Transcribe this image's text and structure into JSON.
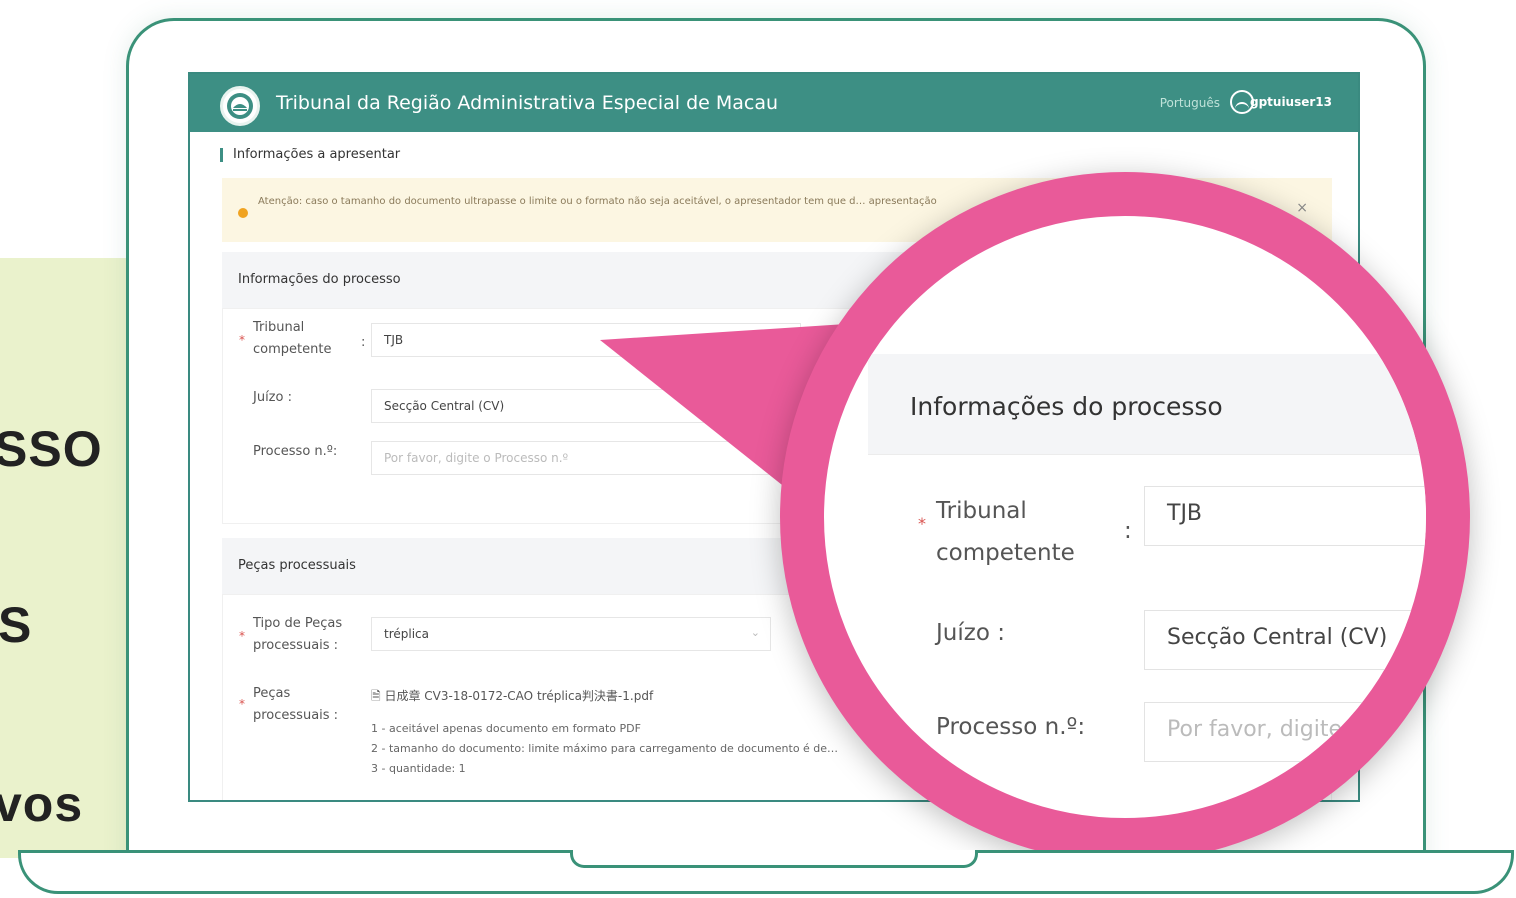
{
  "side_words": [
    "SSO",
    "S",
    "vos"
  ],
  "app": {
    "title": "Tribunal da Região Administrativa Especial de Macau",
    "language": "Português",
    "username": "gptuiuser13"
  },
  "page": {
    "section_title": "Informações a apresentar",
    "alert_text": "Atenção: caso o tamanho do documento ultrapasse o limite ou o formato não seja aceitável, o apresentador tem que d… apresentação",
    "alert_close": "×"
  },
  "process_info": {
    "heading": "Informações do processo",
    "court_label_1": "Tribunal",
    "court_label_2": "competente",
    "colon": ":",
    "court_value": "TJB",
    "juizo_label": "Juízo :",
    "juizo_value": "Secção Central (CV)",
    "processo_label": "Processo n.º:",
    "processo_placeholder": "Por favor, digite o Processo n.º"
  },
  "pieces": {
    "heading": "Peças processuais",
    "type_label_1": "Tipo de Peças",
    "type_label_2": "processuais :",
    "type_value": "tréplica",
    "pieces_label_1": "Peças",
    "pieces_label_2": "processuais :",
    "file_name": "日成章 CV3-18-0172-CAO tréplica判決書-1.pdf",
    "hints": [
      "1 - aceitável apenas documento em formato PDF",
      "2 - tamanho do documento: limite máximo para carregamento de documento é de…",
      "3 - quantidade: 1"
    ]
  },
  "magnifier": {
    "heading": "Informações do processo",
    "court_label_1": "Tribunal",
    "court_label_2": "competente",
    "colon": ":",
    "court_value": "TJB",
    "juizo_label": "Juízo :",
    "juizo_value": "Secção Central (CV)",
    "processo_label": "Processo n.º:",
    "processo_placeholder": "Por favor, digite o Proc"
  },
  "colors": {
    "header_teal": "#3d8f84",
    "laptop_outline": "#3a9278",
    "magnifier_pink": "#e95a99",
    "alert_bg": "#fcf6e2",
    "side_band": "#eaf2cc"
  },
  "icons": [
    "macau-emblem-icon",
    "user-icon",
    "close-icon",
    "chevron-down-icon",
    "file-icon"
  ]
}
